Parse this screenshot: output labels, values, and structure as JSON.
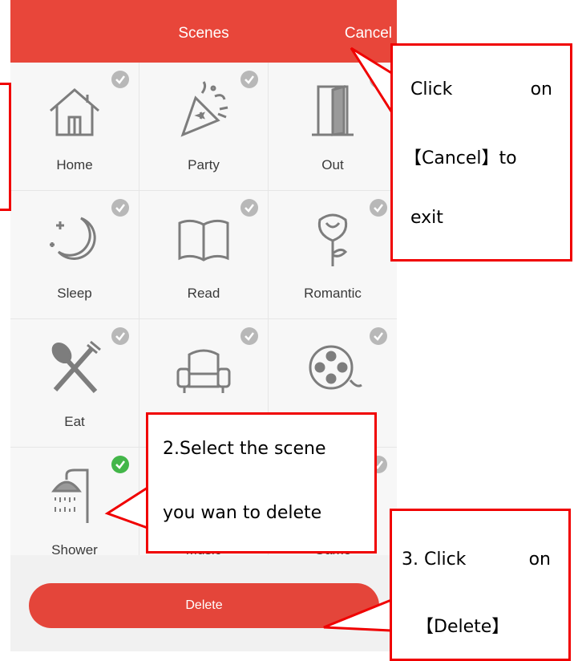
{
  "header": {
    "title": "Scenes",
    "cancel_label": "Cancel"
  },
  "scenes": [
    {
      "label": "Home",
      "icon": "house-icon",
      "selected": false
    },
    {
      "label": "Party",
      "icon": "party-popper-icon",
      "selected": false
    },
    {
      "label": "Out",
      "icon": "door-icon",
      "selected": false
    },
    {
      "label": "Sleep",
      "icon": "moon-stars-icon",
      "selected": false
    },
    {
      "label": "Read",
      "icon": "book-icon",
      "selected": false
    },
    {
      "label": "Romantic",
      "icon": "rose-icon",
      "selected": false
    },
    {
      "label": "Eat",
      "icon": "fork-spoon-icon",
      "selected": false
    },
    {
      "label": "",
      "icon": "sofa-icon",
      "selected": false
    },
    {
      "label": "",
      "icon": "film-reel-icon",
      "selected": false
    },
    {
      "label": "Shower",
      "icon": "shower-icon",
      "selected": true
    },
    {
      "label": "Music",
      "icon": "music-icon",
      "selected": false
    },
    {
      "label": "Game",
      "icon": "game-icon",
      "selected": false
    }
  ],
  "footer": {
    "delete_label": "Delete"
  },
  "callouts": {
    "cancel": {
      "word1": "Click",
      "word2": "on",
      "line2": "【Cancel】to",
      "line3": "exit"
    },
    "select": {
      "line1": "2.Select the scene",
      "line2": "you wan to delete"
    },
    "delete": {
      "word1": "3. Click",
      "word2": "on",
      "line2": "【Delete】"
    }
  },
  "colors": {
    "accent": "#e8463a",
    "check_selected": "#43b649",
    "check_unselected": "#b8b8b8",
    "callout_border": "#f00000"
  }
}
